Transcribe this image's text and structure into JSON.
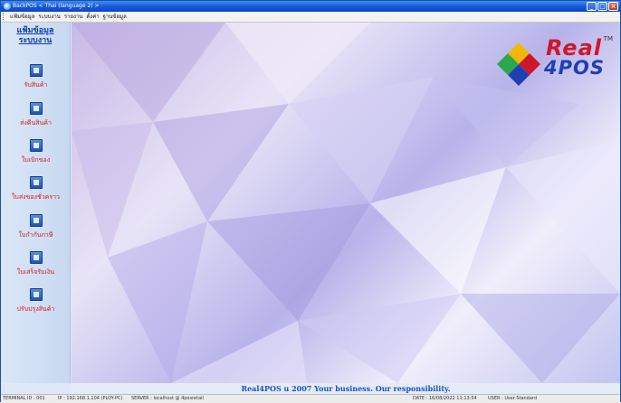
{
  "window": {
    "title": "BackPOS < Thai (language 2) >"
  },
  "menu": {
    "items": [
      "แฟ้มข้อมูล",
      "ระบบงาน",
      "รายงาน",
      "ตั้งค่า",
      "ฐานข้อมูล"
    ]
  },
  "sidebar": {
    "header1": "แฟ้มข้อมูล",
    "header2": "ระบบงาน",
    "items": [
      {
        "label": "รับสินค้า",
        "icon": "receive-goods-icon"
      },
      {
        "label": "ส่งคืนสินค้า",
        "icon": "return-goods-icon"
      },
      {
        "label": "ใบเบิกของ",
        "icon": "requisition-icon"
      },
      {
        "label": "ใบส่งของชั่วคราว",
        "icon": "temporary-delivery-icon"
      },
      {
        "label": "ใบกำกับภาษี",
        "icon": "tax-invoice-icon"
      },
      {
        "label": "ใบเสร็จรับเงิน",
        "icon": "receipt-icon"
      },
      {
        "label": "ปรับปรุงสินค้า",
        "icon": "adjust-goods-icon"
      }
    ]
  },
  "logo": {
    "line1": "Real",
    "line2": "4POS",
    "tm": "TM"
  },
  "slogan": "Real4POS ս 2007 Your business. Our responsibility.",
  "status": {
    "terminal": "TERMINAL ID : 001",
    "ip": "IP : 192.168.1.104 (PLOY-PC)",
    "server": "SERVER : localhost @ 4posretail",
    "date": "DATE : 16/08/2022 11:13:54",
    "user": "USER : User Standard"
  },
  "colors": {
    "titlebar": "#1657d9",
    "accent_red": "#d11a1a",
    "link_blue": "#0d3fb0"
  }
}
